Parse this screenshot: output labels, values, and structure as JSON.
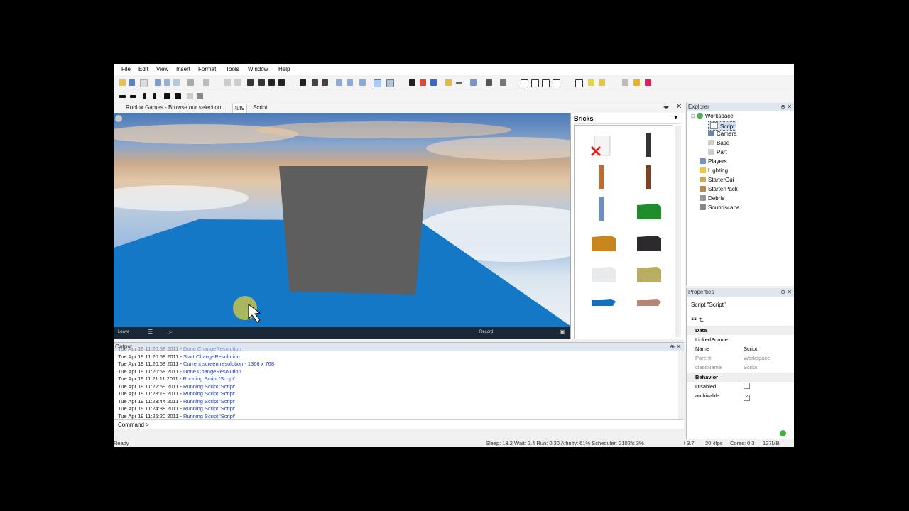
{
  "menu": [
    "File",
    "Edit",
    "View",
    "Insert",
    "Format",
    "Tools",
    "Window",
    "Help"
  ],
  "tabs": [
    "Roblox Games - Browse our selection ...",
    "tut9",
    "Script"
  ],
  "toolbox": {
    "title": "Bricks"
  },
  "explorer": {
    "title": "Explorer",
    "items": [
      {
        "label": "Workspace",
        "icon": "globe-icon"
      },
      {
        "label": "Script",
        "icon": "script-icon"
      },
      {
        "label": "Camera",
        "icon": "camera-icon"
      },
      {
        "label": "Base",
        "icon": "part-icon"
      },
      {
        "label": "Part",
        "icon": "part-icon"
      },
      {
        "label": "Players",
        "icon": "players-icon"
      },
      {
        "label": "Lighting",
        "icon": "lighting-icon"
      },
      {
        "label": "StarterGui",
        "icon": "startergui-icon"
      },
      {
        "label": "StarterPack",
        "icon": "starterpack-icon"
      },
      {
        "label": "Debris",
        "icon": "debris-icon"
      },
      {
        "label": "Soundscape",
        "icon": "soundscape-icon"
      }
    ]
  },
  "properties": {
    "title": "Properties",
    "object": "Script \"Script\"",
    "sections": {
      "data": "Data",
      "behavior": "Behavior"
    },
    "rows": {
      "linked": {
        "name": "LinkedSource",
        "value": ""
      },
      "name": {
        "name": "Name",
        "value": "Script"
      },
      "parent": {
        "name": "Parent",
        "value": "Workspace"
      },
      "classname": {
        "name": "className",
        "value": "Script"
      },
      "disabled": {
        "name": "Disabled",
        "value": ""
      },
      "archivable": {
        "name": "archivable",
        "value": "✓"
      }
    }
  },
  "output": {
    "title": "Output",
    "lines": [
      {
        "ts": "Tue Apr 19 11:20:58 2011",
        "msg": "Done ChangeResolution"
      },
      {
        "ts": "Tue Apr 19 11:20:58 2011",
        "msg": "Start ChangeResolution"
      },
      {
        "ts": "Tue Apr 19 11:20:58 2011",
        "msg": "Current screen resolution - 1366 x 768"
      },
      {
        "ts": "Tue Apr 19 11:20:58 2011",
        "msg": "Done ChangeResolution"
      },
      {
        "ts": "Tue Apr 19 11:21:11 2011",
        "msg": "Running Script 'Script'"
      },
      {
        "ts": "Tue Apr 19 11:22:59 2011",
        "msg": "Running Script 'Script'"
      },
      {
        "ts": "Tue Apr 19 11:23:19 2011",
        "msg": "Running Script 'Script'"
      },
      {
        "ts": "Tue Apr 19 11:23:44 2011",
        "msg": "Running Script 'Script'"
      },
      {
        "ts": "Tue Apr 19 11:24:38 2011",
        "msg": "Running Script 'Script'"
      },
      {
        "ts": "Tue Apr 19 11:25:20 2011",
        "msg": "Running Script 'Script'"
      }
    ]
  },
  "command": {
    "label": "Command >"
  },
  "viewport": {
    "leave": "Leave",
    "record": "Record"
  },
  "status": {
    "ready": "Ready",
    "perf": "Sleep: 13.2 Wait: 2.4 Run: 0.30 Affinity: 61% Scheduler: 2102/s 3%",
    "time": "t 3.7",
    "fps": "20.4fps",
    "cores": "Cores: 0.3",
    "mem": "127MB"
  },
  "colors": {
    "baseplate": "#1277c4",
    "brick": "#5e5e5e",
    "link": "#1a3fbf"
  }
}
